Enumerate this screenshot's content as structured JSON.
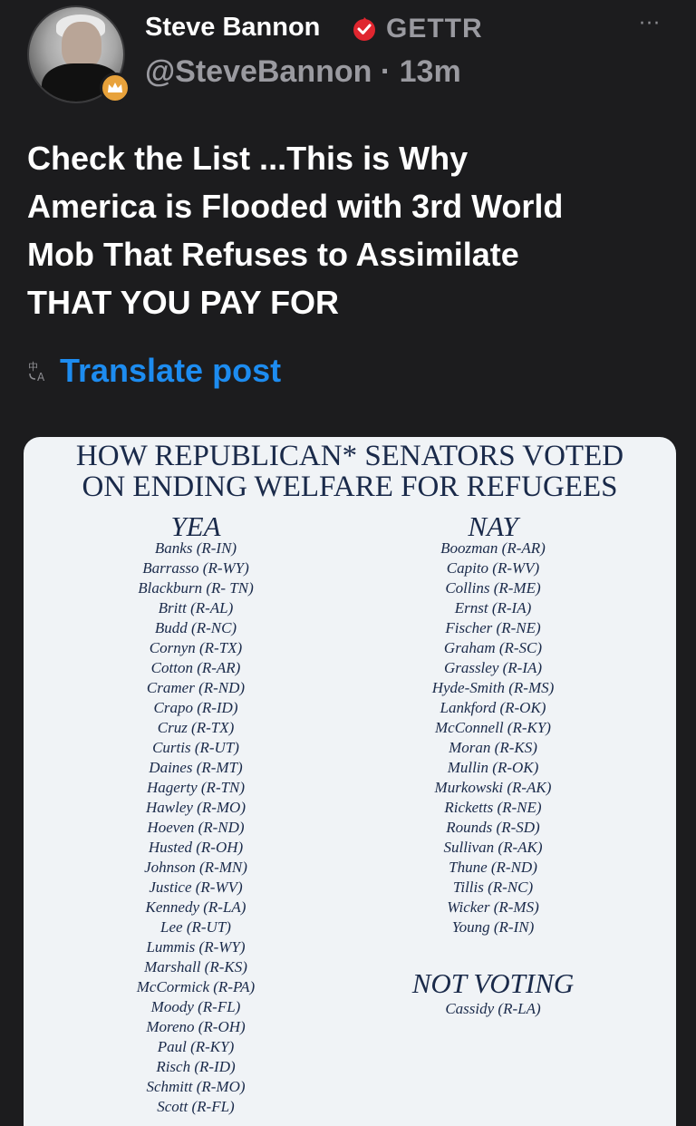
{
  "header": {
    "name": "Steve Bannon",
    "platform": "GETTR",
    "handle_time": "@SteveBannon · 13m",
    "more": "···"
  },
  "post": {
    "lines": [
      "Check the List ...This is Why",
      "America is Flooded with 3rd World",
      "Mob That Refuses to Assimilate",
      "THAT YOU PAY FOR"
    ]
  },
  "translate": {
    "label": "Translate post"
  },
  "image_card": {
    "title_lines": [
      "HOW REPUBLICAN* SENATORS VOTED",
      "ON ENDING WELFARE FOR REFUGEES"
    ],
    "yea_heading": "YEA",
    "yea": [
      "Banks (R-IN)",
      "Barrasso (R-WY)",
      "Blackburn (R- TN)",
      "Britt (R-AL)",
      "Budd (R-NC)",
      "Cornyn (R-TX)",
      "Cotton (R-AR)",
      "Cramer (R-ND)",
      "Crapo (R-ID)",
      "Cruz (R-TX)",
      "Curtis (R-UT)",
      "Daines (R-MT)",
      "Hagerty (R-TN)",
      "Hawley (R-MO)",
      "Hoeven (R-ND)",
      "Husted (R-OH)",
      "Johnson (R-MN)",
      "Justice (R-WV)",
      "Kennedy (R-LA)",
      "Lee (R-UT)",
      "Lummis (R-WY)",
      "Marshall (R-KS)",
      "McCormick (R-PA)",
      "Moody (R-FL)",
      "Moreno (R-OH)",
      "Paul (R-KY)",
      "Risch (R-ID)",
      "Schmitt (R-MO)",
      "Scott (R-FL)"
    ],
    "nay_heading": "NAY",
    "nay": [
      "Boozman (R-AR)",
      "Capito (R-WV)",
      "Collins (R-ME)",
      "Ernst (R-IA)",
      "Fischer (R-NE)",
      "Graham (R-SC)",
      "Grassley (R-IA)",
      "Hyde-Smith (R-MS)",
      "Lankford (R-OK)",
      "McConnell (R-KY)",
      "Moran (R-KS)",
      "Mullin (R-OK)",
      "Murkowski (R-AK)",
      "Ricketts (R-NE)",
      "Rounds (R-SD)",
      "Sullivan (R-AK)",
      "Thune (R-ND)",
      "Tillis (R-NC)",
      "Wicker (R-MS)",
      "Young (R-IN)"
    ],
    "not_voting_heading": "NOT VOTING",
    "not_voting": [
      "Cassidy (R-LA)"
    ]
  },
  "colors": {
    "background": "#1c1c1e",
    "link": "#1d8cf0",
    "secondary_text": "#9a9aa0",
    "gettr_red": "#e0262f",
    "card_background": "#f0f3f6",
    "card_text": "#1a2a4a"
  },
  "icons": [
    "avatar",
    "crown-badge-icon",
    "gettr-logo-icon",
    "more-options-icon",
    "translate-icon"
  ]
}
